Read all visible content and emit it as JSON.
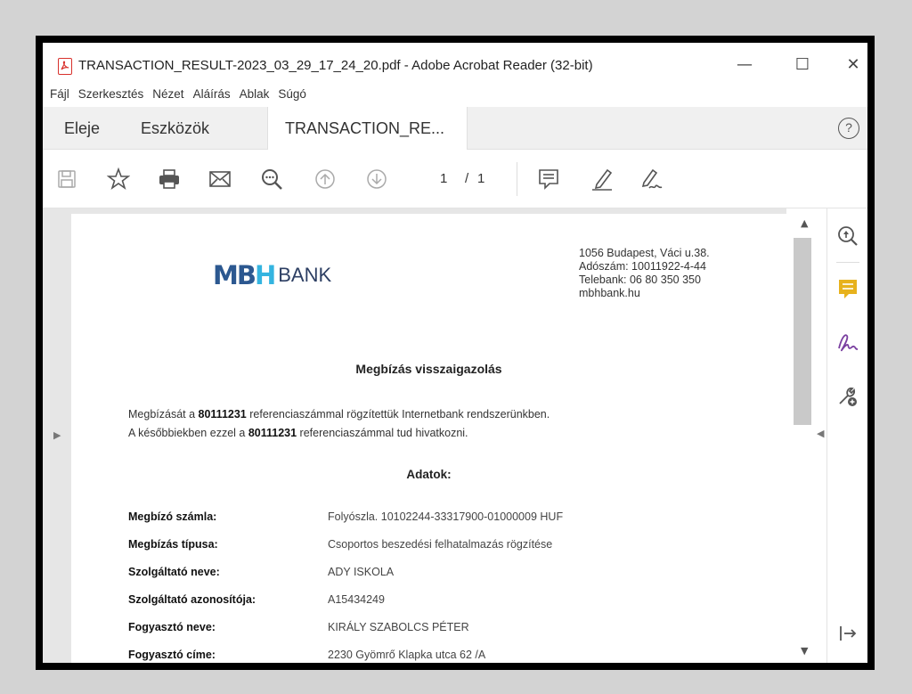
{
  "window": {
    "title": "TRANSACTION_RESULT-2023_03_29_17_24_20.pdf - Adobe Acrobat Reader (32-bit)",
    "minimize": "—",
    "maximize": "☐",
    "close": "✕"
  },
  "menu": [
    "Fájl",
    "Szerkesztés",
    "Nézet",
    "Aláírás",
    "Ablak",
    "Súgó"
  ],
  "tabs": {
    "home": "Eleje",
    "tools": "Eszközök",
    "doc": "TRANSACTION_RE...",
    "doc_close": "×",
    "help": "?"
  },
  "toolbar": {
    "icons": [
      "save-icon",
      "bookmark-star-icon",
      "print-icon",
      "email-icon",
      "zoom-search-icon",
      "page-up-icon",
      "page-down-icon",
      "comment-icon",
      "highlight-pen-icon",
      "sign-icon"
    ],
    "page_current": "1",
    "page_separator": "/",
    "page_total": "1"
  },
  "document": {
    "logo_mark": "MBH",
    "logo_word": "BANK",
    "address_lines": [
      "1056 Budapest, Váci u.38.",
      "Adószám: 10011922-4-44",
      "Telebank: 06 80 350 350",
      "mbhbank.hu"
    ],
    "title": "Megbízás visszaigazolás",
    "para1_pre": "Megbízását a ",
    "ref": "80111231",
    "para1_post": " referenciaszámmal rögzítettük Internetbank rendszerünkben.",
    "para2_pre": "A későbbiekben ezzel a ",
    "para2_post": " referenciaszámmal tud hivatkozni.",
    "section_title": "Adatok:",
    "rows": [
      {
        "label": "Megbízó számla:",
        "value": "Folyószla. 10102244-33317900-01000009 HUF"
      },
      {
        "label": "Megbízás típusa:",
        "value": "Csoportos beszedési felhatalmazás rögzítése"
      },
      {
        "label": "Szolgáltató neve:",
        "value": "ADY ISKOLA"
      },
      {
        "label": "Szolgáltató azonosítója:",
        "value": "A15434249"
      },
      {
        "label": "Fogyasztó neve:",
        "value": "KIRÁLY SZABOLCS PÉTER"
      },
      {
        "label": "Fogyasztó címe:",
        "value": "2230 Gyömrő Klapka utca 62 /A"
      }
    ]
  },
  "colors": {
    "acrobat_red": "#d8312c",
    "mbh_blue": "#2c5890",
    "mbh_cyan": "#34b4e0",
    "comment_yellow": "#e7b21d",
    "sign_purple": "#7a3fa0"
  },
  "right_pane": [
    "zoom-icon",
    "comment-icon",
    "fill-sign-icon",
    "more-tools-icon",
    "collapse-pane-icon"
  ]
}
